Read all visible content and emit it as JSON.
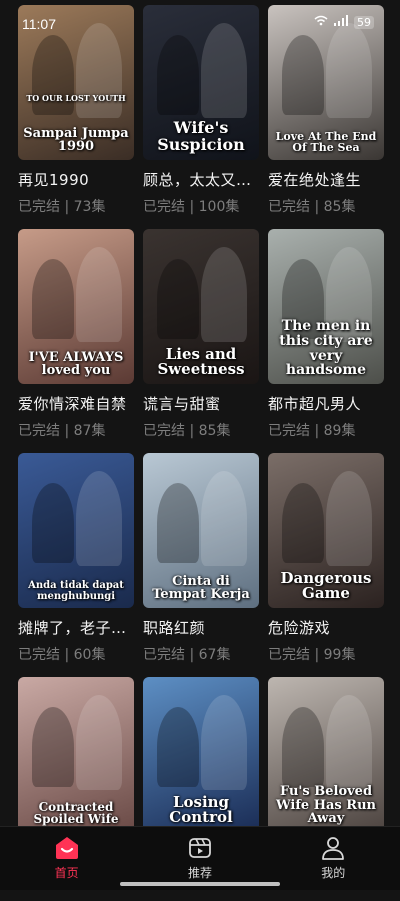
{
  "status_bar": {
    "time": "11:07",
    "battery": "59",
    "icons": [
      "wifi-icon",
      "signal-icon",
      "battery-icon"
    ]
  },
  "dramas": [
    {
      "title": "再见1990",
      "status": "已完结",
      "episodes": "73集",
      "poster_text": "Sampai Jumpa 1990",
      "poster_tagline": "TO OUR LOST YOUTH",
      "colors": [
        "#9c7a5a",
        "#3a2d25"
      ]
    },
    {
      "title": "顾总，太太又…",
      "status": "已完结",
      "episodes": "100集",
      "poster_text": "Wife's Suspicion",
      "colors": [
        "#2a2e3a",
        "#10131a"
      ]
    },
    {
      "title": "爱在绝处逢生",
      "status": "已完结",
      "episodes": "85集",
      "poster_text": "Love At The End Of The Sea",
      "colors": [
        "#c9c3bf",
        "#3a3633"
      ]
    },
    {
      "title": "爱你情深难自禁",
      "status": "已完结",
      "episodes": "87集",
      "poster_text": "I'VE ALWAYS loved you",
      "colors": [
        "#c69b88",
        "#5b3a34"
      ]
    },
    {
      "title": "谎言与甜蜜",
      "status": "已完结",
      "episodes": "85集",
      "poster_text": "Lies and Sweetness",
      "colors": [
        "#3a3330",
        "#1a1514"
      ]
    },
    {
      "title": "都市超凡男人",
      "status": "已完结",
      "episodes": "89集",
      "poster_text": "The men in this city are very handsome",
      "colors": [
        "#a9b0ad",
        "#4d4f4a"
      ]
    },
    {
      "title": "摊牌了，老子…",
      "status": "已完结",
      "episodes": "60集",
      "poster_text": "Anda tidak dapat menghubungi",
      "colors": [
        "#3a5a96",
        "#1a2a4c"
      ]
    },
    {
      "title": "职路红颜",
      "status": "已完结",
      "episodes": "67集",
      "poster_text": "Cinta di Tempat Kerja",
      "colors": [
        "#b9c8d4",
        "#5e6f80"
      ]
    },
    {
      "title": "危险游戏",
      "status": "已完结",
      "episodes": "99集",
      "poster_text": "Dangerous Game",
      "colors": [
        "#7b6e68",
        "#2b2220"
      ]
    },
    {
      "title": "",
      "status": "",
      "episodes": "",
      "poster_text": "Contracted Spoiled Wife",
      "colors": [
        "#c9a9a4",
        "#6a4a46"
      ]
    },
    {
      "title": "",
      "status": "",
      "episodes": "",
      "poster_text": "Losing Control",
      "colors": [
        "#5d8fc4",
        "#1a2c55"
      ]
    },
    {
      "title": "",
      "status": "",
      "episodes": "",
      "poster_text": "Fu's Beloved Wife Has Run Away",
      "colors": [
        "#bdb6b0",
        "#4d4440"
      ]
    }
  ],
  "tabs": [
    {
      "label": "首页",
      "icon": "home-icon",
      "active": true
    },
    {
      "label": "推荐",
      "icon": "clapperboard-icon",
      "active": false
    },
    {
      "label": "我的",
      "icon": "user-icon",
      "active": false
    }
  ],
  "accent_color": "#ff3355"
}
